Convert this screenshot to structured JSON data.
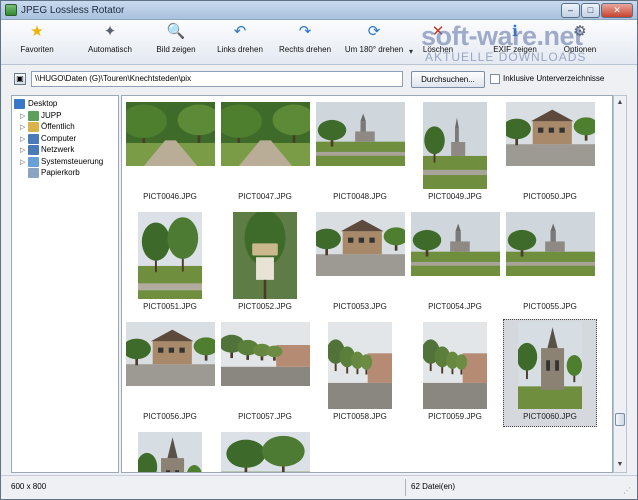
{
  "window": {
    "title": "JPEG Lossless Rotator",
    "minimize": "–",
    "maximize": "□",
    "close": "✕"
  },
  "toolbar": {
    "buttons": [
      {
        "label": "Favoriten",
        "icon": "star-icon",
        "glyph": "★",
        "color": "#e8b500"
      },
      {
        "label": "Automatisch",
        "icon": "magic-wand-icon",
        "glyph": "✦",
        "color": "#5a6070"
      },
      {
        "label": "Bild zeigen",
        "icon": "magnifier-icon",
        "glyph": "🔍",
        "color": "#3d6fb5"
      },
      {
        "label": "Links drehen",
        "icon": "rotate-left-icon",
        "glyph": "↶",
        "color": "#2e77c8"
      },
      {
        "label": "Rechts drehen",
        "icon": "rotate-right-icon",
        "glyph": "↷",
        "color": "#2e77c8"
      },
      {
        "label": "Um 180° drehen",
        "icon": "rotate-180-icon",
        "glyph": "⟳",
        "color": "#2e77c8"
      },
      {
        "label": "Löschen",
        "icon": "delete-icon",
        "glyph": "✕",
        "color": "#c0392b"
      },
      {
        "label": "EXIF zeigen",
        "icon": "exif-icon",
        "glyph": "ℹ",
        "color": "#2e77c8"
      },
      {
        "label": "Optionen",
        "icon": "gear-icon",
        "glyph": "⚙",
        "color": "#5a6070"
      }
    ],
    "dropdown_glyph": "▾"
  },
  "watermark": {
    "main": "soft-ware.net",
    "sub": "AKTUELLE DOWNLOADS"
  },
  "pathbar": {
    "path": "\\\\HUGO\\Daten (G)\\Touren\\Knechtsteden\\pix",
    "browse_label": "Durchsuchen...",
    "include_subdirs_label": "Inklusive Unterverzeichnisse",
    "include_subdirs_checked": false
  },
  "tree": {
    "items": [
      {
        "label": "Desktop",
        "icon": "desktop-icon",
        "color": "#3a78c8",
        "expandable": false,
        "level": 0
      },
      {
        "label": "JUPP",
        "icon": "user-folder-icon",
        "color": "#5aa05a",
        "expandable": true,
        "level": 1
      },
      {
        "label": "Öffentlich",
        "icon": "public-folder-icon",
        "color": "#d8b24a",
        "expandable": true,
        "level": 1
      },
      {
        "label": "Computer",
        "icon": "computer-icon",
        "color": "#4a7ab8",
        "expandable": true,
        "level": 1
      },
      {
        "label": "Netzwerk",
        "icon": "network-icon",
        "color": "#4a7ab8",
        "expandable": true,
        "level": 1
      },
      {
        "label": "Systemsteuerung",
        "icon": "control-panel-icon",
        "color": "#6aa0d8",
        "expandable": true,
        "level": 1
      },
      {
        "label": "Papierkorb",
        "icon": "recycle-bin-icon",
        "color": "#8aa4c4",
        "expandable": false,
        "level": 1
      }
    ]
  },
  "thumbnails": [
    {
      "name": "PICT0046.JPG",
      "orientation": "landscape",
      "scene": "path",
      "selected": false
    },
    {
      "name": "PICT0047.JPG",
      "orientation": "landscape",
      "scene": "path",
      "selected": false
    },
    {
      "name": "PICT0048.JPG",
      "orientation": "landscape",
      "scene": "field",
      "selected": false
    },
    {
      "name": "PICT0049.JPG",
      "orientation": "portrait",
      "scene": "field",
      "selected": false
    },
    {
      "name": "PICT0050.JPG",
      "orientation": "landscape",
      "scene": "building",
      "selected": false
    },
    {
      "name": "PICT0051.JPG",
      "orientation": "portrait",
      "scene": "trees",
      "selected": false
    },
    {
      "name": "PICT0052.JPG",
      "orientation": "portrait",
      "scene": "sign",
      "selected": false
    },
    {
      "name": "PICT0053.JPG",
      "orientation": "landscape",
      "scene": "building",
      "selected": false
    },
    {
      "name": "PICT0054.JPG",
      "orientation": "landscape",
      "scene": "field",
      "selected": false
    },
    {
      "name": "PICT0055.JPG",
      "orientation": "landscape",
      "scene": "field",
      "selected": false
    },
    {
      "name": "PICT0056.JPG",
      "orientation": "landscape",
      "scene": "building",
      "selected": false
    },
    {
      "name": "PICT0057.JPG",
      "orientation": "landscape",
      "scene": "avenue",
      "selected": false
    },
    {
      "name": "PICT0058.JPG",
      "orientation": "portrait",
      "scene": "avenue",
      "selected": false
    },
    {
      "name": "PICT0059.JPG",
      "orientation": "portrait",
      "scene": "avenue",
      "selected": false
    },
    {
      "name": "PICT0060.JPG",
      "orientation": "portrait",
      "scene": "church",
      "selected": true
    },
    {
      "name": "",
      "orientation": "portrait",
      "scene": "church",
      "selected": false
    },
    {
      "name": "",
      "orientation": "landscape",
      "scene": "trees",
      "selected": false
    }
  ],
  "statusbar": {
    "dimensions": "600 x 800",
    "file_count": "62 Datei(en)"
  }
}
